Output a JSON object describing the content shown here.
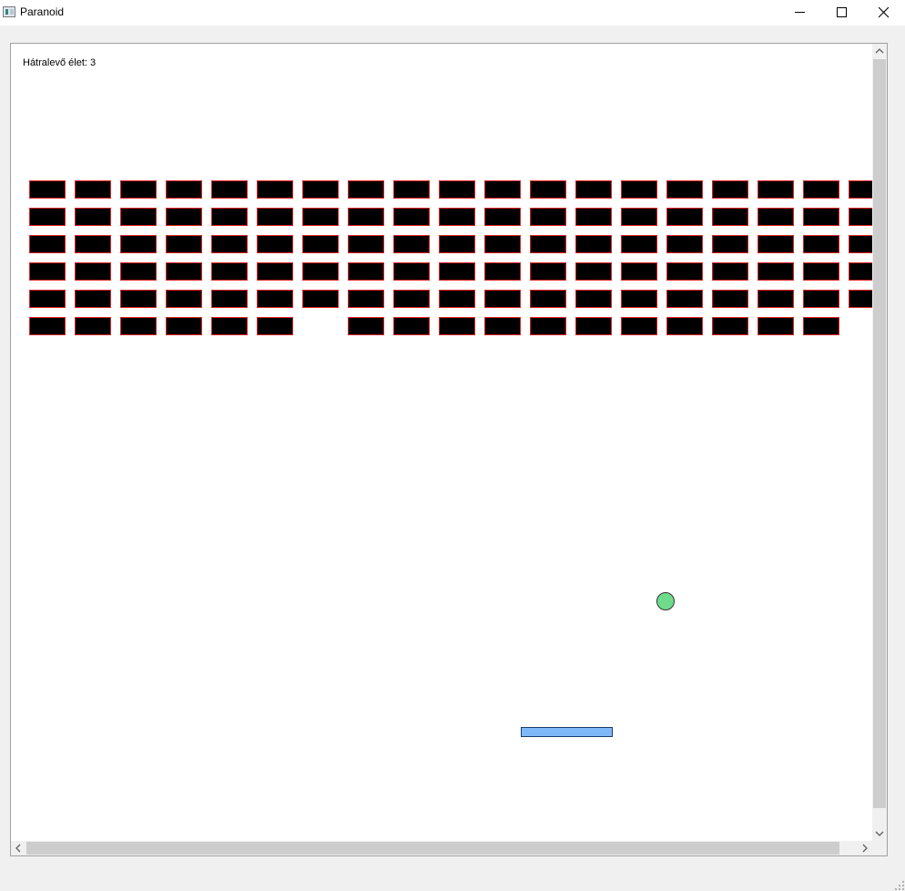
{
  "window": {
    "title": "Paranoid"
  },
  "hud": {
    "lives_text": "Hátralevő élet: 3"
  },
  "bricks": {
    "fill": "#000000",
    "border": "#e02020",
    "rows_present": [
      [
        1,
        1,
        1,
        1,
        1,
        1,
        1,
        1,
        1,
        1,
        1,
        1,
        1,
        1,
        1,
        1,
        1,
        1,
        1
      ],
      [
        1,
        1,
        1,
        1,
        1,
        1,
        1,
        1,
        1,
        1,
        1,
        1,
        1,
        1,
        1,
        1,
        1,
        1,
        1
      ],
      [
        1,
        1,
        1,
        1,
        1,
        1,
        1,
        1,
        1,
        1,
        1,
        1,
        1,
        1,
        1,
        1,
        1,
        1,
        1
      ],
      [
        1,
        1,
        1,
        1,
        1,
        1,
        1,
        1,
        1,
        1,
        1,
        1,
        1,
        1,
        1,
        1,
        1,
        1,
        1
      ],
      [
        1,
        1,
        1,
        1,
        1,
        1,
        1,
        1,
        1,
        1,
        1,
        1,
        1,
        1,
        1,
        1,
        1,
        1,
        1
      ],
      [
        1,
        1,
        1,
        1,
        1,
        1,
        0,
        1,
        1,
        1,
        1,
        1,
        1,
        1,
        1,
        1,
        1,
        1,
        0
      ]
    ]
  },
  "ball": {
    "color": "#6fdc8c"
  },
  "paddle": {
    "color": "#7eb8f7"
  },
  "icons": {
    "app": "app-icon",
    "minimize": "minimize-icon",
    "maximize": "maximize-icon",
    "close": "close-icon",
    "scroll_up": "chevron-up-icon",
    "scroll_down": "chevron-down-icon",
    "scroll_left": "chevron-left-icon",
    "scroll_right": "chevron-right-icon"
  }
}
